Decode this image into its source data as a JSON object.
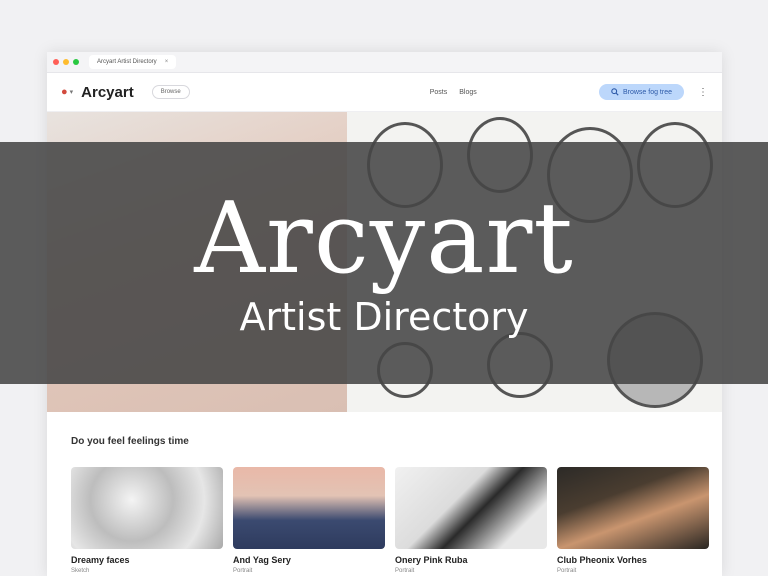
{
  "browser": {
    "tab_label": "Arcyart Artist Directory",
    "tab_close": "×"
  },
  "navbar": {
    "brand": "Arcyart",
    "pill": "Browse",
    "links": [
      "Posts",
      "Blogs"
    ],
    "search_label": "Browse fog tree",
    "more_icon": "⋮"
  },
  "banner": {
    "title": "Arcyart",
    "subtitle": "Artist Directory"
  },
  "section": {
    "title": "Do you feel feelings time"
  },
  "cards": [
    {
      "name": "Dreamy faces",
      "sub": "Sketch"
    },
    {
      "name": "And Yag Sery",
      "sub": "Portrait"
    },
    {
      "name": "Onery Pink Ruba",
      "sub": "Portrait"
    },
    {
      "name": "Club Pheonix Vorhes",
      "sub": "Portrait"
    }
  ],
  "colors": {
    "accent": "#bcd7fb",
    "overlay": "#464646",
    "brand_mark": "#d24a3e"
  }
}
